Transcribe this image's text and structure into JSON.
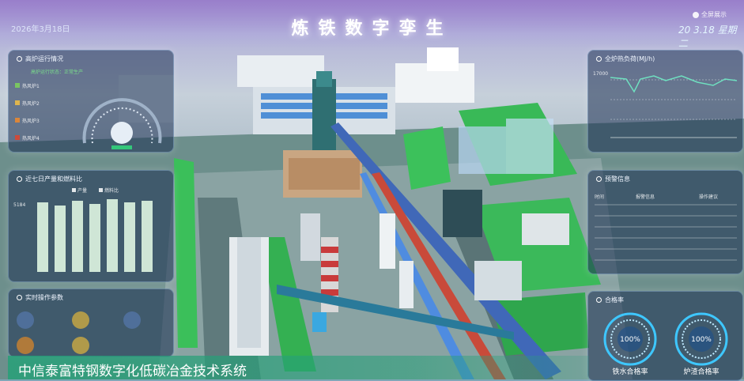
{
  "header": {
    "title": "炼铁数字孪生",
    "date_left": "2026年3月18日",
    "fullscreen_label": "全屏展示",
    "date_right": "20 3.18 星期二"
  },
  "left_panels": {
    "furnace_status": {
      "title": "高炉运行情况",
      "status_text": "高炉运行状态：正常生产",
      "legend": [
        "热风炉1",
        "热风炉2",
        "热风炉3",
        "热风炉4"
      ]
    },
    "weekly_output": {
      "title": "近七日产量和燃料比",
      "legend": [
        "产量",
        "燃料比"
      ],
      "y_tick": "5184"
    },
    "realtime_params": {
      "title": "实时操作参数"
    }
  },
  "right_panels": {
    "heat_load": {
      "title": "全炉热负荷(MJ/h)",
      "y_top": "17000"
    },
    "alerts": {
      "title": "预警信息",
      "columns": [
        "时间",
        "报警信息",
        "操作建议"
      ]
    },
    "qualified": {
      "title": "合格率",
      "rings": [
        {
          "value": "100%",
          "label": "铁水合格率"
        },
        {
          "value": "100%",
          "label": "炉渣合格率"
        }
      ]
    }
  },
  "caption": "中信泰富特钢数字化低碳冶金技术系统",
  "colors": {
    "caption_bg": "#26a078",
    "ring": "#3ec7ff",
    "chart_line": "#6fe0c0"
  }
}
